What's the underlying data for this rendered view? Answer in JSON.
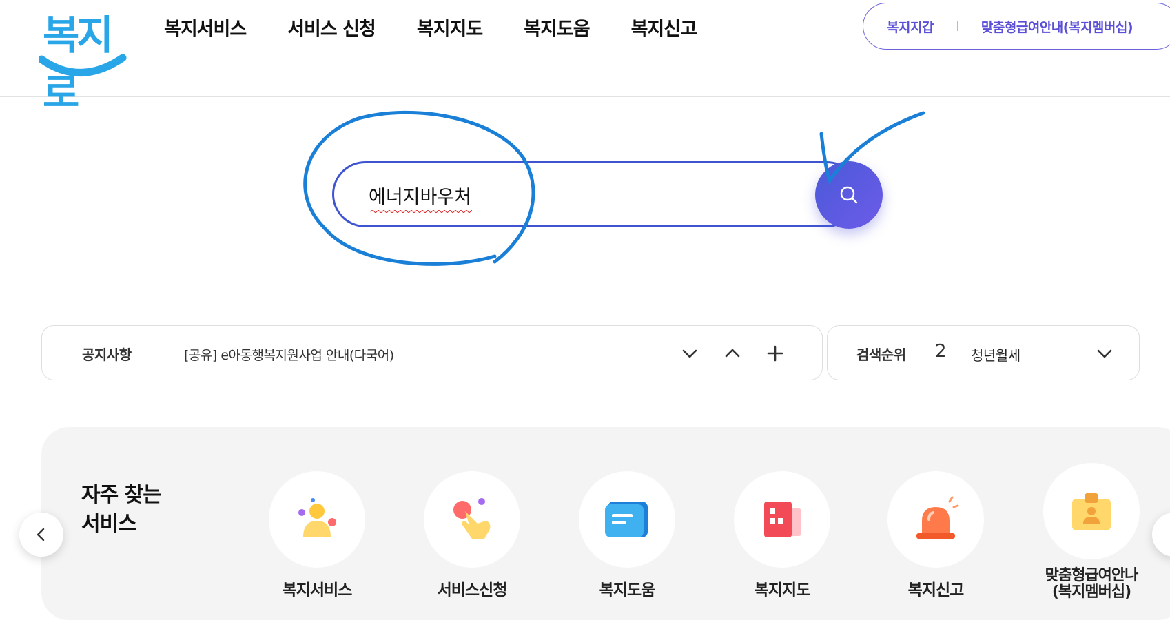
{
  "header": {
    "logo_text": "복지로",
    "nav": [
      "복지서비스",
      "서비스 신청",
      "복지지도",
      "복지도움",
      "복지신고"
    ],
    "util_links": [
      "복지지갑",
      "맞춤형급여안내(복지멤버십)"
    ]
  },
  "search": {
    "value": "에너지바우처",
    "placeholder": ""
  },
  "notice": {
    "label": "공지사항",
    "text": "[공유] e아동행복지원사업 안내(다국어)"
  },
  "ranking": {
    "label": "검색순위",
    "number": "2",
    "text": "청년월세"
  },
  "frequent": {
    "title_line1": "자주 찾는",
    "title_line2": "서비스",
    "services": [
      {
        "label": "복지서비스",
        "icon": "person-icon"
      },
      {
        "label": "서비스신청",
        "icon": "hand-pointer-icon"
      },
      {
        "label": "복지도움",
        "icon": "chat-icon"
      },
      {
        "label": "복지지도",
        "icon": "map-icon"
      },
      {
        "label": "복지신고",
        "icon": "siren-icon"
      },
      {
        "label": "맞춤형급여안나 (복지멤버십)",
        "icon": "id-card-icon"
      }
    ]
  },
  "colors": {
    "brand_blue": "#29a6e8",
    "accent_purple": "#5a4fd6",
    "search_border": "#3f54d1",
    "annotation": "#1a7fd6"
  }
}
